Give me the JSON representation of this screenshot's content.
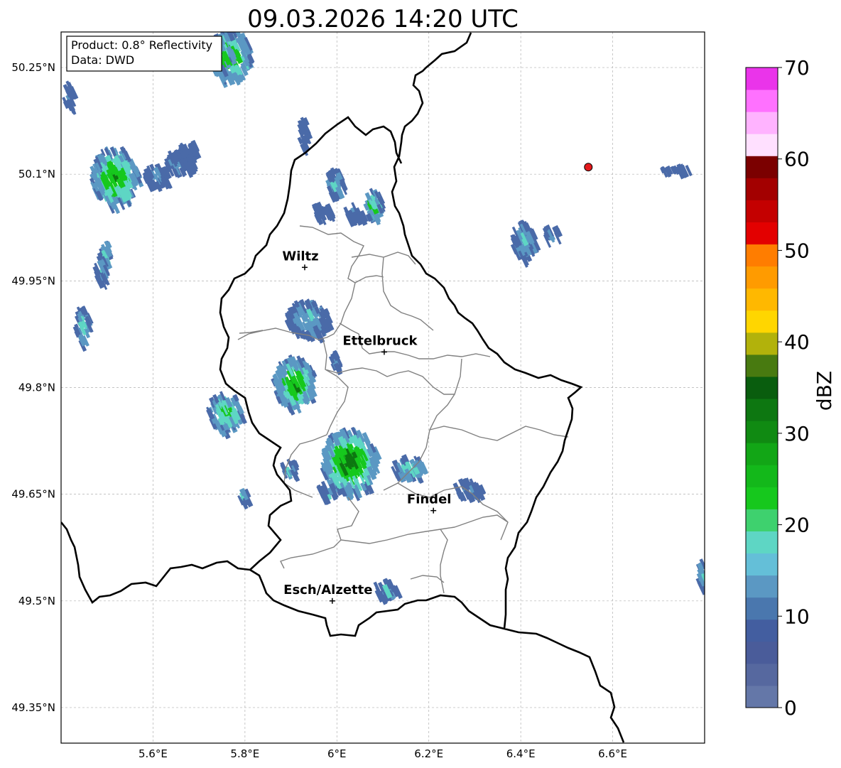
{
  "title": "09.03.2026 14:20 UTC",
  "info_box": {
    "product": "Product: 0.8° Reflectivity",
    "data_source": "Data: DWD"
  },
  "axes": {
    "lon_range": [
      5.4,
      6.8
    ],
    "lat_range": [
      49.3,
      50.3
    ],
    "x_ticks": [
      {
        "value": 5.6,
        "label": "5.6°E"
      },
      {
        "value": 5.8,
        "label": "5.8°E"
      },
      {
        "value": 6.0,
        "label": "6°E"
      },
      {
        "value": 6.2,
        "label": "6.2°E"
      },
      {
        "value": 6.4,
        "label": "6.4°E"
      },
      {
        "value": 6.6,
        "label": "6.6°E"
      }
    ],
    "y_ticks": [
      {
        "value": 50.25,
        "label": "50.25°N"
      },
      {
        "value": 50.1,
        "label": "50.1°N"
      },
      {
        "value": 49.95,
        "label": "49.95°N"
      },
      {
        "value": 49.8,
        "label": "49.8°N"
      },
      {
        "value": 49.65,
        "label": "49.65°N"
      },
      {
        "value": 49.5,
        "label": "49.5°N"
      },
      {
        "value": 49.35,
        "label": "49.35°N"
      }
    ],
    "grid": true
  },
  "cities": [
    {
      "name": "Wiltz",
      "lon": 5.93,
      "lat": 49.969
    },
    {
      "name": "Ettelbruck",
      "lon": 6.103,
      "lat": 49.85
    },
    {
      "name": "Findel",
      "lon": 6.21,
      "lat": 49.627
    },
    {
      "name": "Esch/Alzette",
      "lon": 5.99,
      "lat": 49.5
    }
  ],
  "radar_site": {
    "lon": 6.547,
    "lat": 50.11,
    "color": "#e41a1c"
  },
  "colorbar": {
    "label": "dBZ",
    "min": 0,
    "max": 70,
    "ticks": [
      {
        "value": 0,
        "label": "0"
      },
      {
        "value": 10,
        "label": "10"
      },
      {
        "value": 20,
        "label": "20"
      },
      {
        "value": 30,
        "label": "30"
      },
      {
        "value": 40,
        "label": "40"
      },
      {
        "value": 50,
        "label": "50"
      },
      {
        "value": 60,
        "label": "60"
      },
      {
        "value": 70,
        "label": "70"
      }
    ],
    "colors": [
      "#6477a8",
      "#56689f",
      "#4a5c9a",
      "#435ea0",
      "#4a77ae",
      "#5b98c3",
      "#64bfd8",
      "#5ed6c4",
      "#3ed16e",
      "#16c81d",
      "#13b81a",
      "#12a616",
      "#108a12",
      "#0d7711",
      "#095d0e",
      "#487a10",
      "#b2b20b",
      "#ffd600",
      "#ffb800",
      "#ff9b00",
      "#ff7d00",
      "#e30000",
      "#c40000",
      "#a30000",
      "#7b0000",
      "#ffe0ff",
      "#ffb3ff",
      "#ff71ff",
      "#ea34ea"
    ]
  },
  "echo_colors": {
    "light": "#4a6aa8",
    "blue": "#5b98c3",
    "cyan": "#5ed6c4",
    "green": "#16c81d",
    "dark_green": "#0d7711",
    "yellow": "#c8b400"
  },
  "echo_cells": [
    {
      "lon": 5.76,
      "lat": 50.27,
      "rlon": 0.045,
      "rlat": 0.035,
      "level": 30
    },
    {
      "lon": 5.51,
      "lat": 50.1,
      "rlon": 0.05,
      "rlat": 0.04,
      "level": 30
    },
    {
      "lon": 5.9,
      "lat": 49.81,
      "rlon": 0.045,
      "rlat": 0.035,
      "level": 30
    },
    {
      "lon": 6.02,
      "lat": 49.7,
      "rlon": 0.06,
      "rlat": 0.045,
      "level": 35
    },
    {
      "lon": 5.75,
      "lat": 49.77,
      "rlon": 0.035,
      "rlat": 0.025,
      "level": 25
    },
    {
      "lon": 5.93,
      "lat": 49.9,
      "rlon": 0.045,
      "rlat": 0.025,
      "level": 15
    },
    {
      "lon": 6.15,
      "lat": 49.69,
      "rlon": 0.035,
      "rlat": 0.015,
      "level": 20
    },
    {
      "lon": 6.4,
      "lat": 50.01,
      "rlon": 0.025,
      "rlat": 0.025,
      "level": 15
    },
    {
      "lon": 5.44,
      "lat": 49.89,
      "rlon": 0.015,
      "rlat": 0.025,
      "level": 18
    },
    {
      "lon": 5.49,
      "lat": 49.99,
      "rlon": 0.01,
      "rlat": 0.02,
      "level": 18
    },
    {
      "lon": 5.6,
      "lat": 50.1,
      "rlon": 0.03,
      "rlat": 0.015,
      "level": 10
    },
    {
      "lon": 5.65,
      "lat": 50.12,
      "rlon": 0.03,
      "rlat": 0.015,
      "level": 10
    },
    {
      "lon": 6.07,
      "lat": 50.06,
      "rlon": 0.02,
      "rlat": 0.02,
      "level": 22
    },
    {
      "lon": 5.99,
      "lat": 50.09,
      "rlon": 0.02,
      "rlat": 0.02,
      "level": 15
    },
    {
      "lon": 6.28,
      "lat": 49.66,
      "rlon": 0.03,
      "rlat": 0.012,
      "level": 10
    },
    {
      "lon": 6.1,
      "lat": 49.52,
      "rlon": 0.025,
      "rlat": 0.01,
      "level": 12
    },
    {
      "lon": 5.97,
      "lat": 49.66,
      "rlon": 0.015,
      "rlat": 0.01,
      "level": 18
    },
    {
      "lon": 5.89,
      "lat": 49.69,
      "rlon": 0.015,
      "rlat": 0.01,
      "level": 18
    },
    {
      "lon": 5.79,
      "lat": 49.65,
      "rlon": 0.01,
      "rlat": 0.008,
      "level": 14
    },
    {
      "lon": 6.79,
      "lat": 49.54,
      "rlon": 0.012,
      "rlat": 0.02,
      "level": 18
    },
    {
      "lon": 5.41,
      "lat": 50.21,
      "rlon": 0.01,
      "rlat": 0.02,
      "level": 8
    },
    {
      "lon": 5.48,
      "lat": 49.97,
      "rlon": 0.012,
      "rlat": 0.02,
      "level": 16
    },
    {
      "lon": 5.99,
      "lat": 49.84,
      "rlon": 0.01,
      "rlat": 0.012,
      "level": 10
    },
    {
      "lon": 6.46,
      "lat": 50.02,
      "rlon": 0.015,
      "rlat": 0.01,
      "level": 14
    },
    {
      "lon": 6.73,
      "lat": 50.11,
      "rlon": 0.03,
      "rlat": 0.006,
      "level": 6
    },
    {
      "lon": 5.67,
      "lat": 50.13,
      "rlon": 0.02,
      "rlat": 0.02,
      "level": 6
    },
    {
      "lon": 5.92,
      "lat": 50.16,
      "rlon": 0.01,
      "rlat": 0.02,
      "level": 6
    },
    {
      "lon": 5.96,
      "lat": 50.05,
      "rlon": 0.02,
      "rlat": 0.01,
      "level": 6
    },
    {
      "lon": 6.03,
      "lat": 50.05,
      "rlon": 0.02,
      "rlat": 0.01,
      "level": 6
    },
    {
      "lon": 5.74,
      "lat": 50.27,
      "rlon": 0.025,
      "rlat": 0.02,
      "level": 34
    }
  ]
}
